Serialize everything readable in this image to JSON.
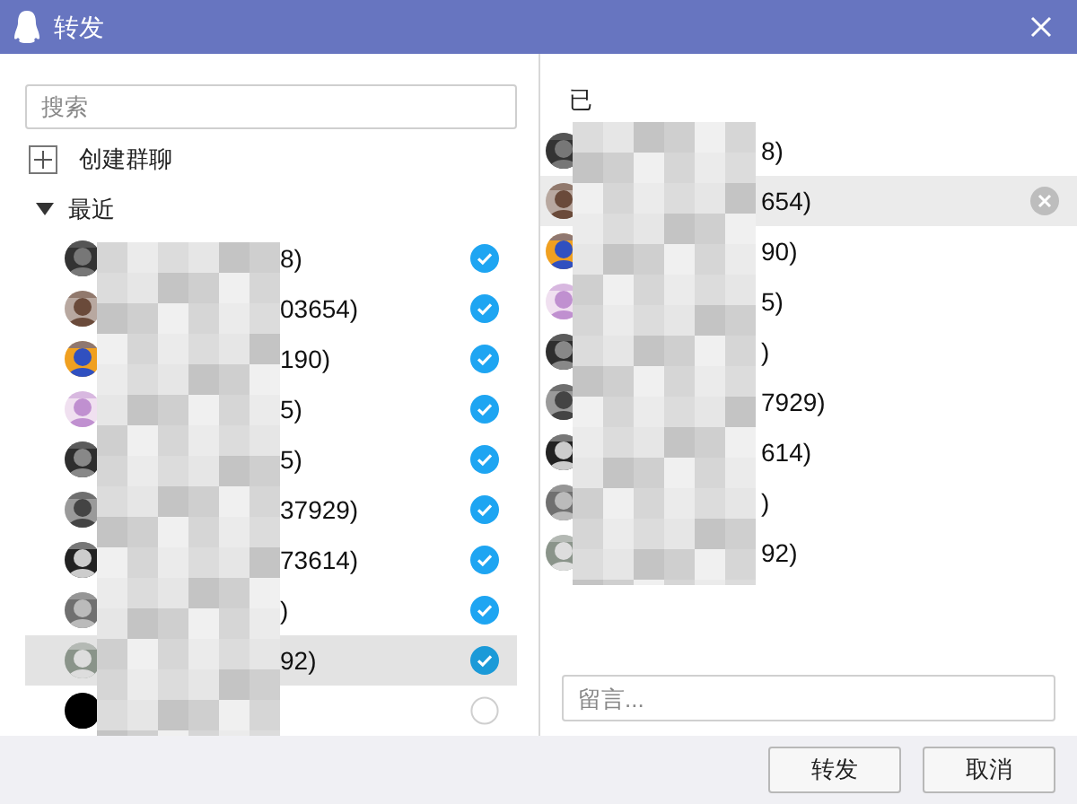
{
  "window": {
    "title": "转发"
  },
  "search": {
    "placeholder": "搜索"
  },
  "create_group": {
    "label": "创建群聊"
  },
  "recent": {
    "label": "最近",
    "expanded": true,
    "contacts": [
      {
        "name": "8)",
        "checked": true,
        "selected": false
      },
      {
        "name": "03654)",
        "checked": true,
        "selected": false
      },
      {
        "name": "190)",
        "checked": true,
        "selected": false
      },
      {
        "name": "5)",
        "checked": true,
        "selected": false
      },
      {
        "name": "5)",
        "checked": true,
        "selected": false
      },
      {
        "name": "37929)",
        "checked": true,
        "selected": false
      },
      {
        "name": "73614)",
        "checked": true,
        "selected": false
      },
      {
        "name": ")",
        "checked": true,
        "selected": false
      },
      {
        "name": "92)",
        "checked": true,
        "selected": true
      },
      {
        "checked": false,
        "selected": false
      }
    ]
  },
  "chosen": {
    "header": "已",
    "items": [
      {
        "name": "8)",
        "selected": false
      },
      {
        "name": "654)",
        "selected": true
      },
      {
        "name": "90)",
        "selected": false
      },
      {
        "name": "5)",
        "selected": false
      },
      {
        "name": ")",
        "selected": false
      },
      {
        "name": "7929)",
        "selected": false
      },
      {
        "name": "614)",
        "selected": false
      },
      {
        "name": ")",
        "selected": false
      },
      {
        "name": "92)",
        "selected": false
      }
    ]
  },
  "message": {
    "placeholder": "留言..."
  },
  "buttons": [
    "转发",
    "取消"
  ]
}
